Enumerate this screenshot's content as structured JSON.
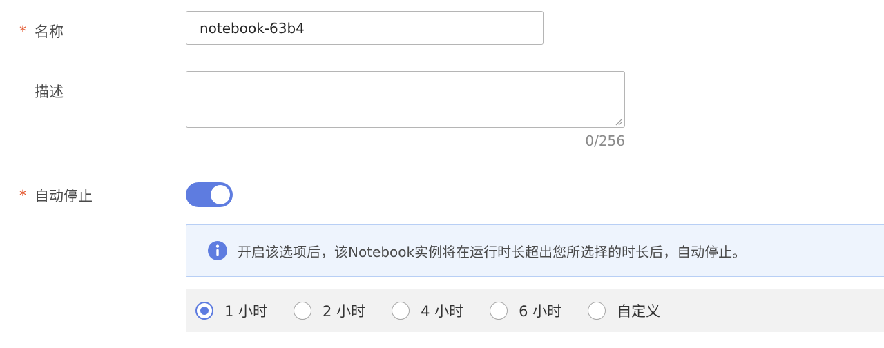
{
  "form": {
    "name": {
      "required_mark": "*",
      "label": "名称",
      "value": "notebook-63b4"
    },
    "description": {
      "label": "描述",
      "value": "",
      "counter": "0/256"
    },
    "auto_stop": {
      "required_mark": "*",
      "label": "自动停止",
      "enabled": true,
      "info_icon": "info-icon",
      "info_text": "开启该选项后，该Notebook实例将在运行时长超出您所选择的时长后，自动停止。",
      "options": [
        {
          "label": "1 小时",
          "selected": true
        },
        {
          "label": "2 小时",
          "selected": false
        },
        {
          "label": "4 小时",
          "selected": false
        },
        {
          "label": "6 小时",
          "selected": false
        },
        {
          "label": "自定义",
          "selected": false
        }
      ]
    }
  },
  "colors": {
    "accent": "#5e7ce0",
    "required": "#e4572e",
    "info_bg": "#eef4fd",
    "info_border": "#b8cff5"
  }
}
